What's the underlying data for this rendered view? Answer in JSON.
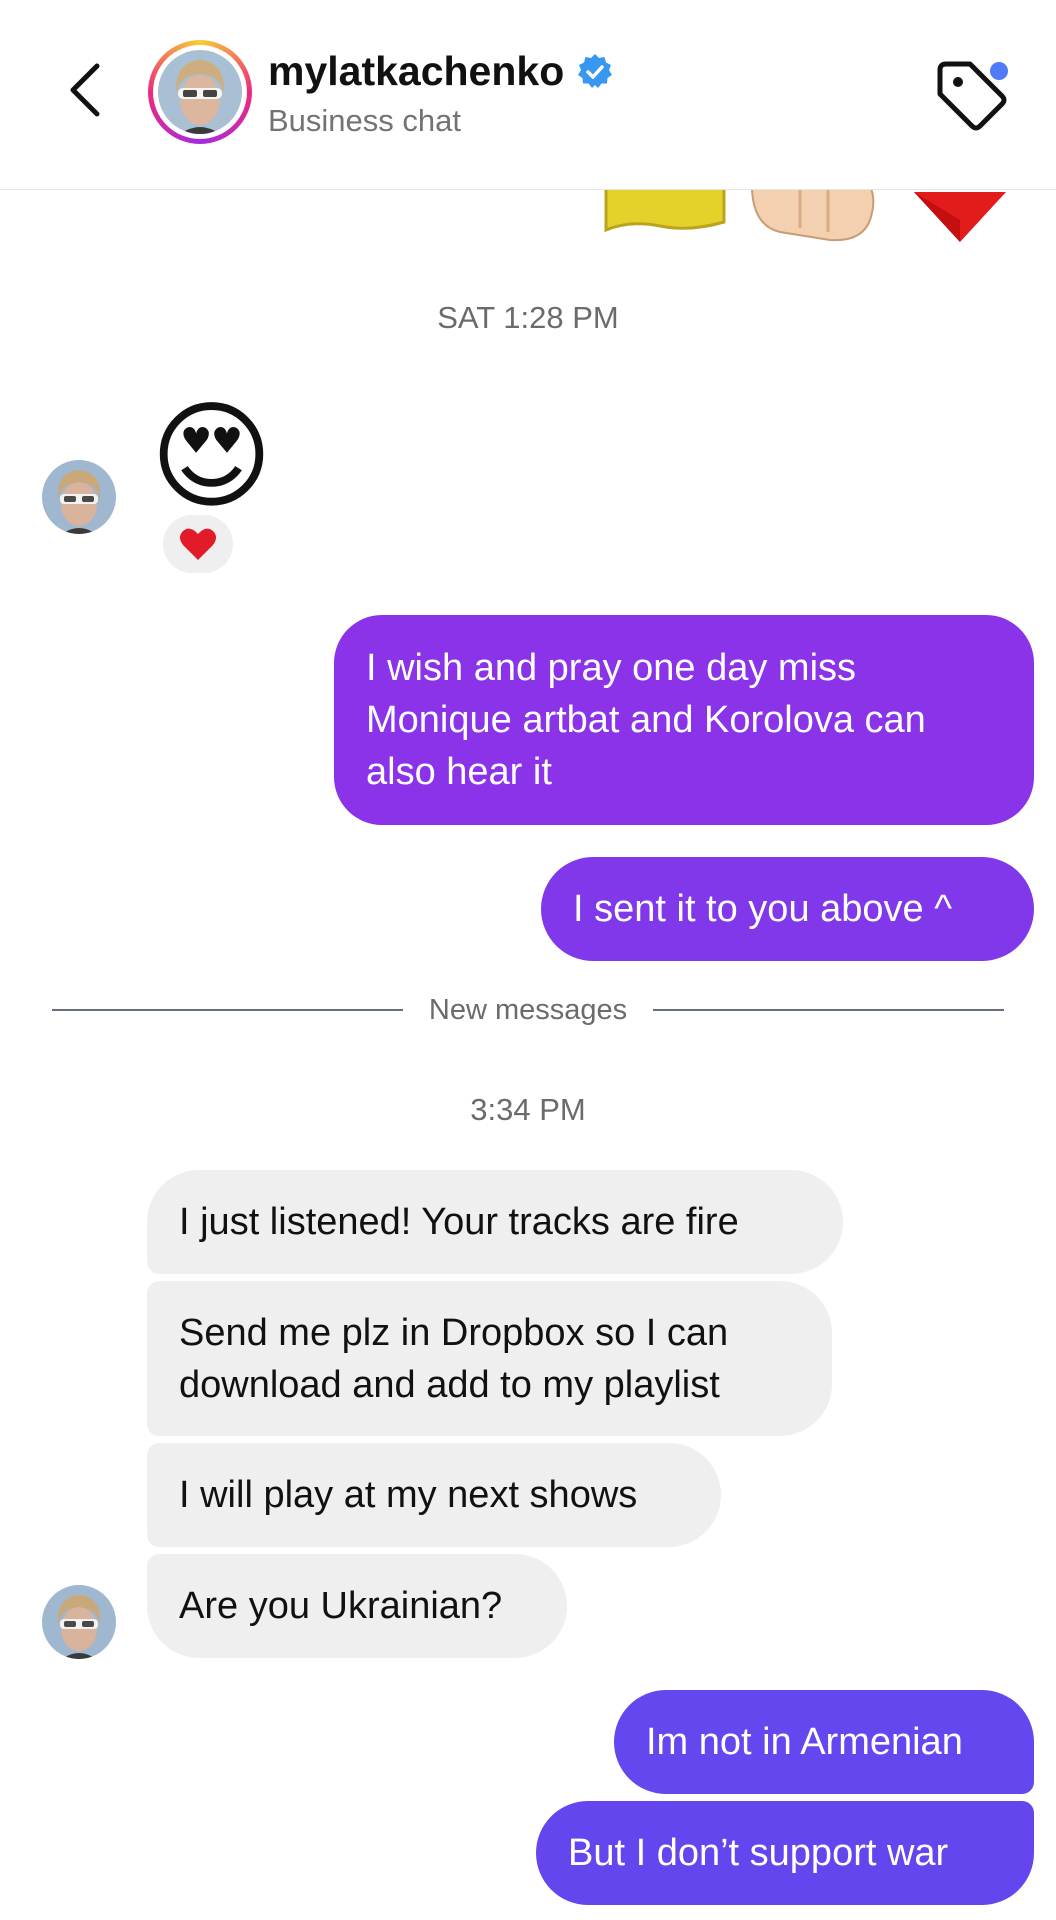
{
  "header": {
    "username": "mylatkachenko",
    "subtitle": "Business chat",
    "verified": true
  },
  "colors": {
    "outgoing_purple": "#8a33e8",
    "outgoing_blue_purple": "#6547ef",
    "incoming_bg": "#efeff0",
    "verified_blue": "#3897f0",
    "notification_dot": "#4f7cf6"
  },
  "messages": {
    "timestamp_1": "SAT 1:28 PM",
    "sticker_emoji": "😍",
    "reaction_emoji": "❤️",
    "out_1": "I wish and pray one day miss Monique artbat and Korolova can also hear it",
    "out_2": "I sent it to you above ^",
    "divider": "New messages",
    "timestamp_2": "3:34 PM",
    "in_1": "I just listened! Your tracks are fire",
    "in_2": "Send me plz in Dropbox so I can download and add to my playlist",
    "in_3": "I will play at my next shows",
    "in_4": "Are you Ukrainian?",
    "out_3": "Im not in Armenian",
    "out_4": "But I don’t support war"
  },
  "icons": [
    "back-chevron-icon",
    "verified-badge-icon",
    "tag-icon",
    "heart-icon",
    "partial-emoji-flag-icon",
    "partial-emoji-fist-icon",
    "partial-emoji-heart-icon"
  ]
}
